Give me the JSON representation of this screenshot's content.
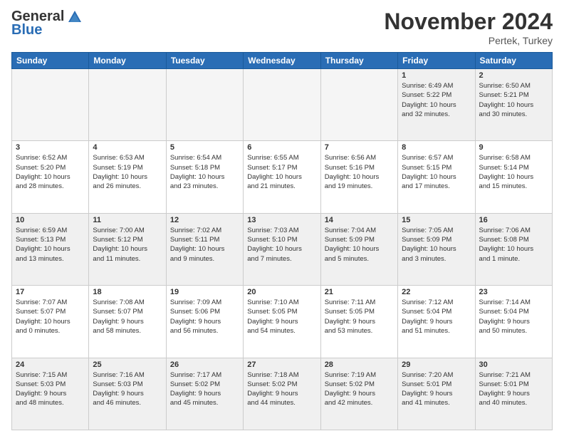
{
  "header": {
    "logo_general": "General",
    "logo_blue": "Blue",
    "month_title": "November 2024",
    "subtitle": "Pertek, Turkey"
  },
  "weekdays": [
    "Sunday",
    "Monday",
    "Tuesday",
    "Wednesday",
    "Thursday",
    "Friday",
    "Saturday"
  ],
  "weeks": [
    [
      {
        "day": "",
        "info": ""
      },
      {
        "day": "",
        "info": ""
      },
      {
        "day": "",
        "info": ""
      },
      {
        "day": "",
        "info": ""
      },
      {
        "day": "",
        "info": ""
      },
      {
        "day": "1",
        "info": "Sunrise: 6:49 AM\nSunset: 5:22 PM\nDaylight: 10 hours\nand 32 minutes."
      },
      {
        "day": "2",
        "info": "Sunrise: 6:50 AM\nSunset: 5:21 PM\nDaylight: 10 hours\nand 30 minutes."
      }
    ],
    [
      {
        "day": "3",
        "info": "Sunrise: 6:52 AM\nSunset: 5:20 PM\nDaylight: 10 hours\nand 28 minutes."
      },
      {
        "day": "4",
        "info": "Sunrise: 6:53 AM\nSunset: 5:19 PM\nDaylight: 10 hours\nand 26 minutes."
      },
      {
        "day": "5",
        "info": "Sunrise: 6:54 AM\nSunset: 5:18 PM\nDaylight: 10 hours\nand 23 minutes."
      },
      {
        "day": "6",
        "info": "Sunrise: 6:55 AM\nSunset: 5:17 PM\nDaylight: 10 hours\nand 21 minutes."
      },
      {
        "day": "7",
        "info": "Sunrise: 6:56 AM\nSunset: 5:16 PM\nDaylight: 10 hours\nand 19 minutes."
      },
      {
        "day": "8",
        "info": "Sunrise: 6:57 AM\nSunset: 5:15 PM\nDaylight: 10 hours\nand 17 minutes."
      },
      {
        "day": "9",
        "info": "Sunrise: 6:58 AM\nSunset: 5:14 PM\nDaylight: 10 hours\nand 15 minutes."
      }
    ],
    [
      {
        "day": "10",
        "info": "Sunrise: 6:59 AM\nSunset: 5:13 PM\nDaylight: 10 hours\nand 13 minutes."
      },
      {
        "day": "11",
        "info": "Sunrise: 7:00 AM\nSunset: 5:12 PM\nDaylight: 10 hours\nand 11 minutes."
      },
      {
        "day": "12",
        "info": "Sunrise: 7:02 AM\nSunset: 5:11 PM\nDaylight: 10 hours\nand 9 minutes."
      },
      {
        "day": "13",
        "info": "Sunrise: 7:03 AM\nSunset: 5:10 PM\nDaylight: 10 hours\nand 7 minutes."
      },
      {
        "day": "14",
        "info": "Sunrise: 7:04 AM\nSunset: 5:09 PM\nDaylight: 10 hours\nand 5 minutes."
      },
      {
        "day": "15",
        "info": "Sunrise: 7:05 AM\nSunset: 5:09 PM\nDaylight: 10 hours\nand 3 minutes."
      },
      {
        "day": "16",
        "info": "Sunrise: 7:06 AM\nSunset: 5:08 PM\nDaylight: 10 hours\nand 1 minute."
      }
    ],
    [
      {
        "day": "17",
        "info": "Sunrise: 7:07 AM\nSunset: 5:07 PM\nDaylight: 10 hours\nand 0 minutes."
      },
      {
        "day": "18",
        "info": "Sunrise: 7:08 AM\nSunset: 5:07 PM\nDaylight: 9 hours\nand 58 minutes."
      },
      {
        "day": "19",
        "info": "Sunrise: 7:09 AM\nSunset: 5:06 PM\nDaylight: 9 hours\nand 56 minutes."
      },
      {
        "day": "20",
        "info": "Sunrise: 7:10 AM\nSunset: 5:05 PM\nDaylight: 9 hours\nand 54 minutes."
      },
      {
        "day": "21",
        "info": "Sunrise: 7:11 AM\nSunset: 5:05 PM\nDaylight: 9 hours\nand 53 minutes."
      },
      {
        "day": "22",
        "info": "Sunrise: 7:12 AM\nSunset: 5:04 PM\nDaylight: 9 hours\nand 51 minutes."
      },
      {
        "day": "23",
        "info": "Sunrise: 7:14 AM\nSunset: 5:04 PM\nDaylight: 9 hours\nand 50 minutes."
      }
    ],
    [
      {
        "day": "24",
        "info": "Sunrise: 7:15 AM\nSunset: 5:03 PM\nDaylight: 9 hours\nand 48 minutes."
      },
      {
        "day": "25",
        "info": "Sunrise: 7:16 AM\nSunset: 5:03 PM\nDaylight: 9 hours\nand 46 minutes."
      },
      {
        "day": "26",
        "info": "Sunrise: 7:17 AM\nSunset: 5:02 PM\nDaylight: 9 hours\nand 45 minutes."
      },
      {
        "day": "27",
        "info": "Sunrise: 7:18 AM\nSunset: 5:02 PM\nDaylight: 9 hours\nand 44 minutes."
      },
      {
        "day": "28",
        "info": "Sunrise: 7:19 AM\nSunset: 5:02 PM\nDaylight: 9 hours\nand 42 minutes."
      },
      {
        "day": "29",
        "info": "Sunrise: 7:20 AM\nSunset: 5:01 PM\nDaylight: 9 hours\nand 41 minutes."
      },
      {
        "day": "30",
        "info": "Sunrise: 7:21 AM\nSunset: 5:01 PM\nDaylight: 9 hours\nand 40 minutes."
      }
    ]
  ]
}
